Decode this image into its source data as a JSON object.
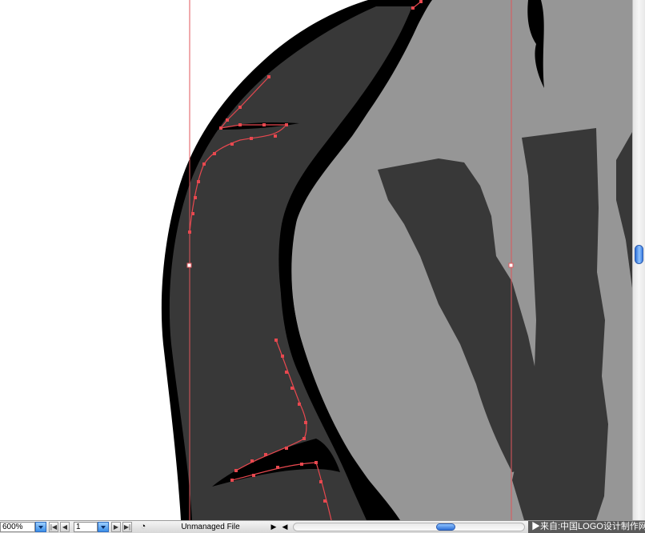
{
  "status_bar": {
    "zoom_value": "600%",
    "page_value": "1",
    "document_status": "Unmanaged File"
  },
  "watermark": {
    "text": "▶来自:中国LOGO设计制作网"
  },
  "colors": {
    "canvas_bg": "#ffffff",
    "outline": "#000000",
    "dark_fill": "#383838",
    "light_fill": "#969696",
    "guide_line": "#e0565b",
    "path_selection": "#e8484f",
    "scroll_thumb": "#3a7be0"
  },
  "icons": [
    "first-page-icon",
    "prev-page-icon",
    "next-page-icon",
    "last-page-icon",
    "status-menu-icon",
    "play-arrow-icon"
  ]
}
